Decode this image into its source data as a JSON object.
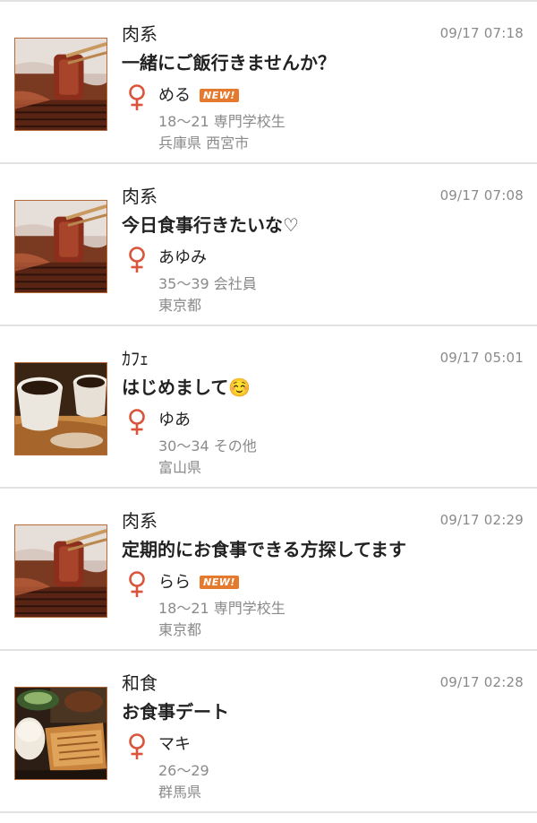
{
  "posts": [
    {
      "category": "肉系",
      "time": "09/17 07:18",
      "title": "一緒にご飯行きませんか？",
      "name": "める",
      "is_new": true,
      "new_label": "NEW!",
      "age": "18〜21",
      "occupation": "専門学校生",
      "details": "18〜21 専門学校生",
      "location": "兵庫県 西宮市",
      "thumbnail": "grilled-meat-photo"
    },
    {
      "category": "肉系",
      "time": "09/17 07:08",
      "title": "今日食事行きたいな♡",
      "name": "あゆみ",
      "is_new": false,
      "age": "35〜39",
      "occupation": "会社員",
      "details": "35〜39 会社員",
      "location": "東京都",
      "thumbnail": "grilled-meat-photo"
    },
    {
      "category": "ｶﾌｪ",
      "time": "09/17 05:01",
      "title": "はじめまして☺️",
      "name": "ゆあ",
      "is_new": false,
      "age": "30〜34",
      "occupation": "その他",
      "details": "30〜34 その他",
      "location": "富山県",
      "thumbnail": "coffee-cups-photo"
    },
    {
      "category": "肉系",
      "time": "09/17 02:29",
      "title": "定期的にお食事できる方探してます",
      "name": "らら",
      "is_new": true,
      "new_label": "NEW!",
      "age": "18〜21",
      "occupation": "専門学校生",
      "details": "18〜21 専門学校生",
      "location": "東京都",
      "thumbnail": "grilled-meat-photo"
    },
    {
      "category": "和食",
      "time": "09/17 02:28",
      "title": "お食事デート",
      "name": "マキ",
      "is_new": false,
      "age": "26〜29",
      "occupation": "",
      "details": "26〜29",
      "location": "群馬県",
      "thumbnail": "japanese-meal-photo"
    }
  ],
  "colors": {
    "female_icon": "#d9543a",
    "new_badge": "#e57a2e",
    "divider": "#e2e2e2",
    "muted_text": "#8a8a8a"
  }
}
